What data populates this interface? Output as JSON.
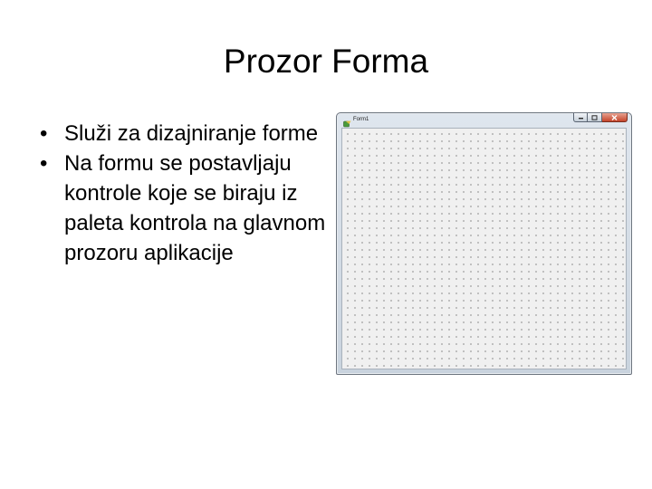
{
  "slide": {
    "title": "Prozor Forma",
    "bullets": [
      {
        "marker": "•",
        "text": "Služi za dizajniranje forme"
      },
      {
        "marker": "•",
        "text": "Na formu se postavljaju kontrole koje se biraju iz paleta kontrola na glavnom prozoru aplikacije"
      }
    ]
  },
  "form_window": {
    "title": "Form1",
    "icon": "delphi-form-icon",
    "buttons": [
      {
        "name": "minimize-icon"
      },
      {
        "name": "maximize-icon"
      },
      {
        "name": "close-icon"
      }
    ]
  },
  "colors": {
    "title_bar": "#d3dbe4",
    "close_button": "#c5452b",
    "client_area": "#f0f0f0",
    "grid_dot": "#2e2e2e"
  }
}
